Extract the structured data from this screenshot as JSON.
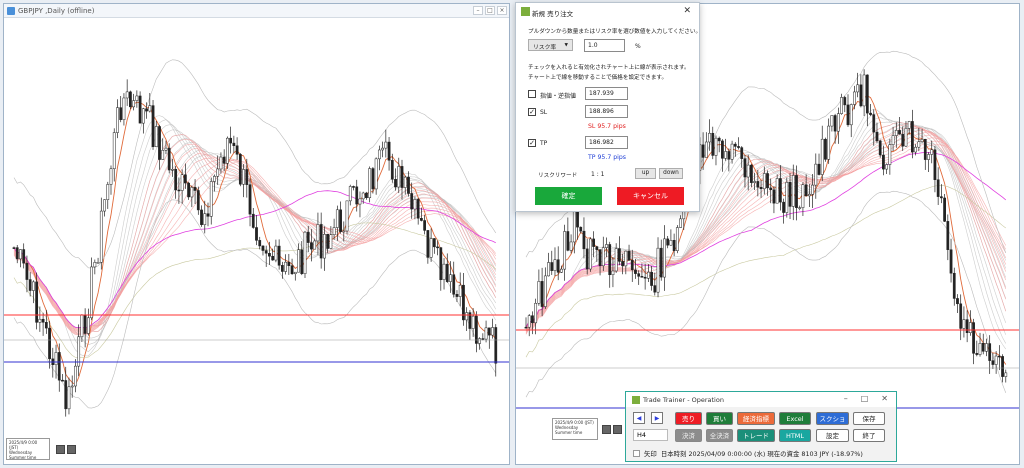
{
  "left_window": {
    "title": "GBPJPY ,Daily (offline)",
    "controls": [
      "–",
      "□",
      "×"
    ],
    "info_lines": [
      "2025/4/9 0:00 (JST)",
      "Wednesday",
      "Summer time",
      "0/1"
    ]
  },
  "right_window": {
    "controls": [
      "–",
      "□",
      "×"
    ],
    "info_lines": [
      "2025/4/9 0:00 (JST)",
      "Wednesday",
      "Summer time",
      "H4"
    ]
  },
  "order_dialog": {
    "title": "新規 売り注文",
    "close": "✕",
    "instruction": "プルダウンから数量またはリスク率を選び数値を入力してください。",
    "risk_select": "リスク率",
    "risk_value": "1.0",
    "risk_unit": "%",
    "note_line1": "チェックを入れると有効化されチャート上に線が表示されます。",
    "note_line2": "チャート上で線を移動することで価格を設定できます。",
    "limit_label": "指値・逆指値",
    "limit_value": "187.939",
    "limit_checked": false,
    "sl_label": "SL",
    "sl_value": "188.896",
    "sl_checked": true,
    "sl_pips": "SL 95.7 pips",
    "tp_label": "TP",
    "tp_value": "186.982",
    "tp_checked": true,
    "tp_pips": "TP 95.7 pips",
    "rr_label": "リスクリワード",
    "rr_value": "1 : 1",
    "up": "up",
    "down": "down",
    "confirm": "確定",
    "cancel": "キャンセル"
  },
  "trade_trainer": {
    "title": "Trade Trainer - Operation",
    "controls": [
      "–",
      "□",
      "✕"
    ],
    "prev": "◀",
    "next": "▶",
    "timeframe": "H4",
    "sell": "売り",
    "buy": "買い",
    "close_limit": "経済指標",
    "excel": "Excel",
    "screenshot": "スクショ",
    "save": "保存",
    "settle": "決済",
    "settle_all": "全決済",
    "trade": "トレード",
    "html": "HTML",
    "settings": "設定",
    "exit": "終了",
    "arrow_label": "矢印",
    "status": "日本時刻 2025/04/09 0:00:00 (水)   現在の資金 8103 JPY (-18.97%)"
  },
  "colors": {
    "sl_line": "#ff3030",
    "tp_line": "#3030d0",
    "ma_band": "#f4a0a0",
    "grey_band": "#b8b8b8",
    "magenta": "#e040e0"
  }
}
